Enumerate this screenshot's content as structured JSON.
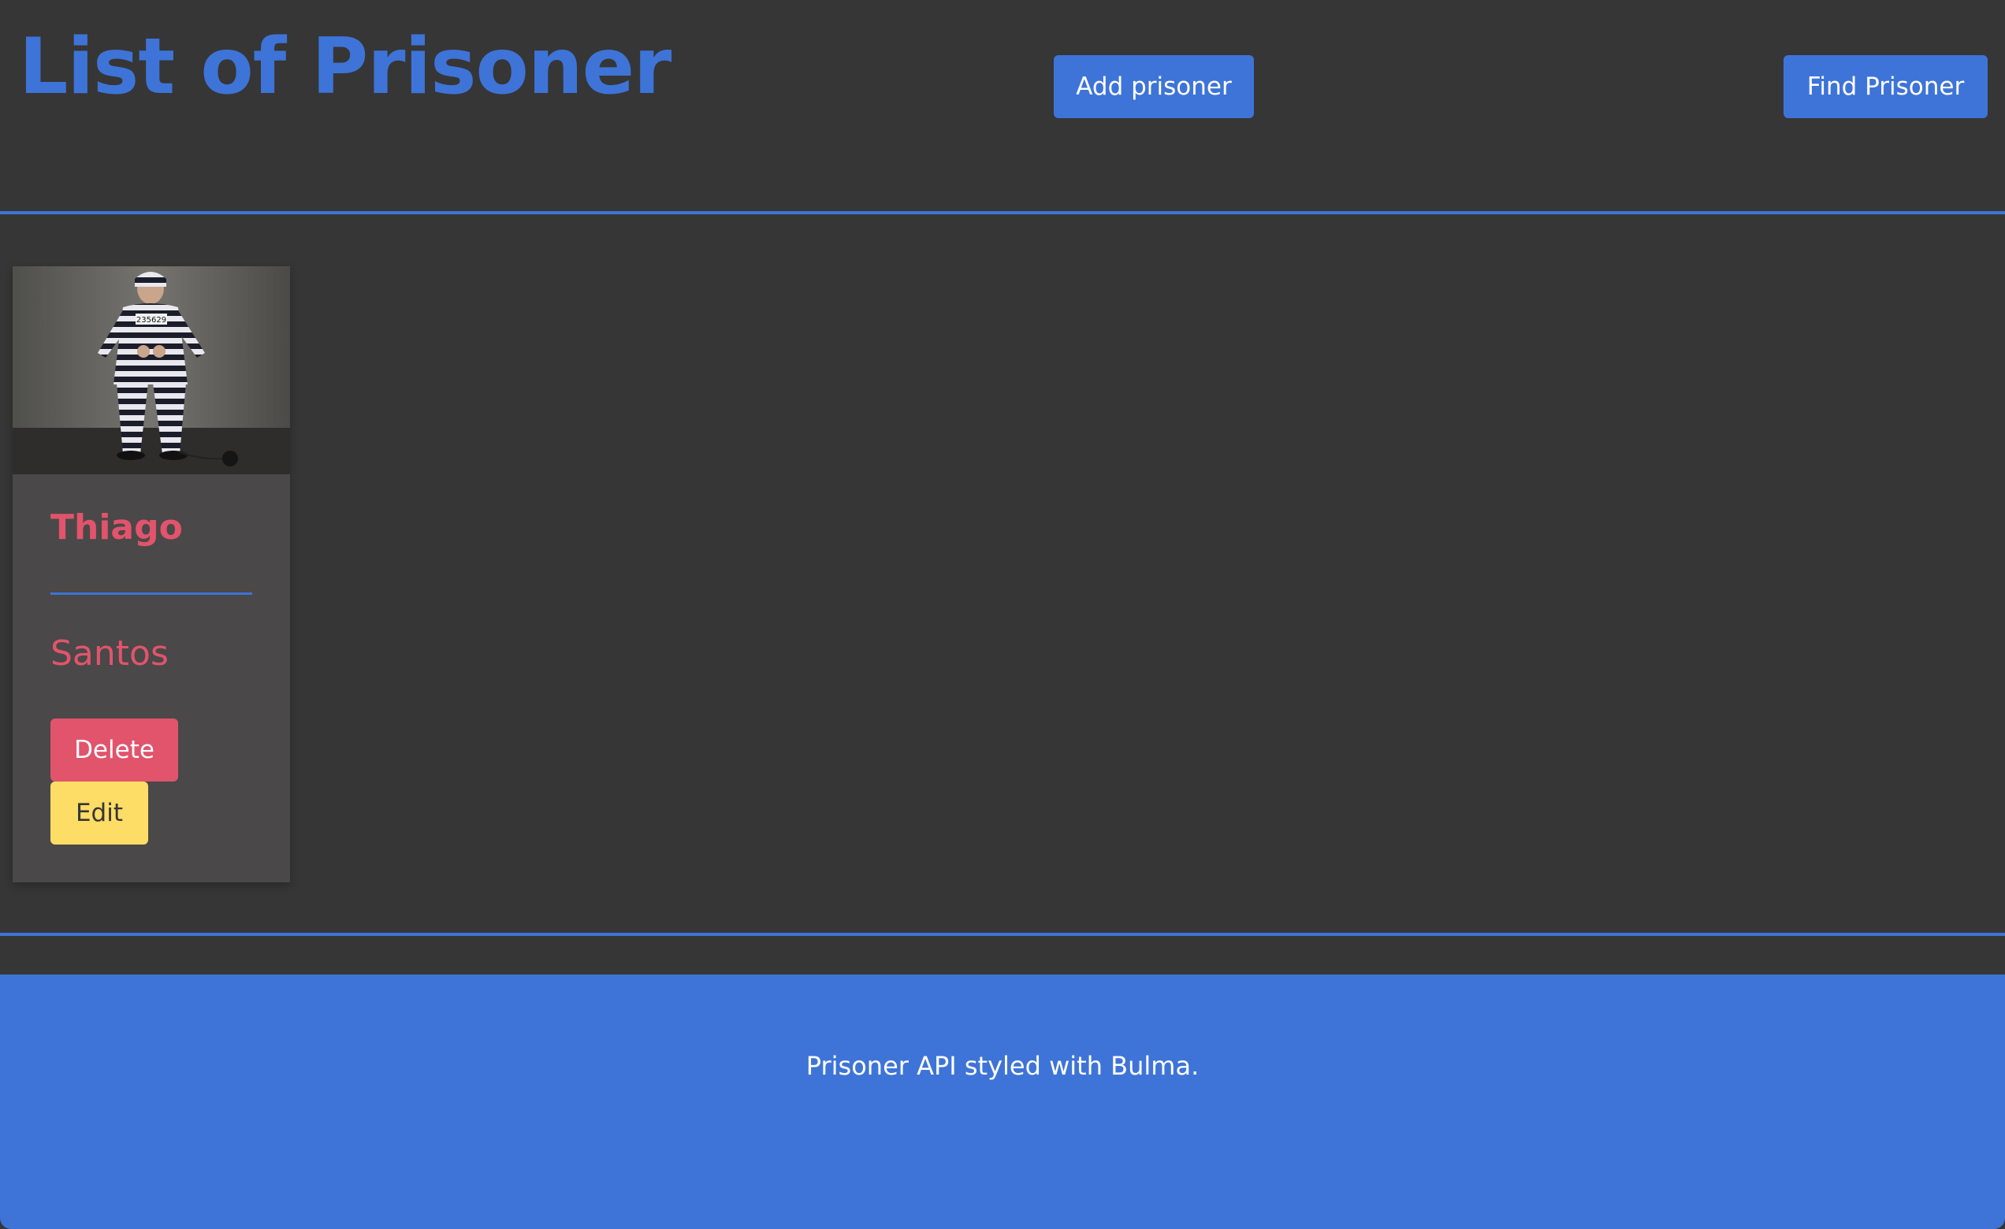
{
  "header": {
    "title": "List of Prisoner",
    "add_button_label": "Add prisoner",
    "find_button_label": "Find Prisoner"
  },
  "prisoners": [
    {
      "first_name": "Thiago",
      "last_name": "Santos",
      "photo_badge": "235629",
      "delete_label": "Delete",
      "edit_label": "Edit"
    }
  ],
  "footer": {
    "text": "Prisoner API styled with Bulma."
  },
  "colors": {
    "background": "#363636",
    "primary": "#3e74d7",
    "danger": "#e1546c",
    "warning": "#fedd66",
    "card": "#4a4848"
  }
}
